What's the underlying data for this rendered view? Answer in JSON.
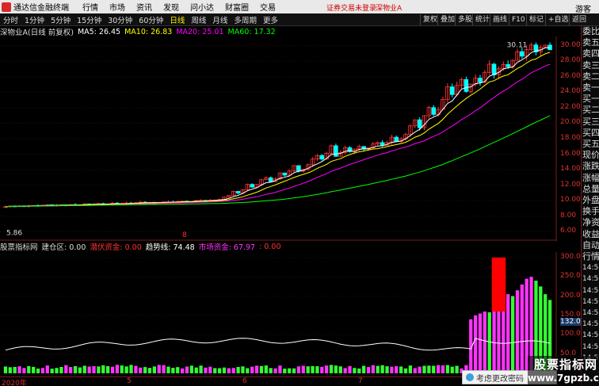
{
  "menubar": {
    "app_name": "通达信金融终端",
    "items": [
      "行情",
      "市场",
      "资讯",
      "发现",
      "问小达",
      "财富圈",
      "交易"
    ],
    "notice": "证券交易未登录",
    "stock_link": "深物业A",
    "guest": "游客"
  },
  "toolbar": {
    "periods": [
      "分时",
      "1分钟",
      "5分钟",
      "15分钟",
      "30分钟",
      "60分钟",
      "日线",
      "周线",
      "月线",
      "多周期",
      "更多"
    ],
    "active_period": "日线",
    "right_buttons": [
      "复权",
      "叠加",
      "多股",
      "统计",
      "画线",
      "F10",
      "标记",
      "+自选",
      "返回"
    ]
  },
  "chart_header": {
    "title": "深物业A(日线 前复权)",
    "ma5_label": "MA5: 26.45",
    "ma10_label": "MA10: 26.83",
    "ma20_label": "MA20: 25.01",
    "ma60_label": "MA60: 17.32"
  },
  "price_axis": [
    "30.00",
    "28.00",
    "26.00",
    "24.00",
    "22.00",
    "20.00",
    "18.00",
    "16.00",
    "14.00",
    "12.00",
    "10.00",
    "8.00",
    "6.00"
  ],
  "annotations": {
    "high_label": "30.11",
    "low_label": "5.86",
    "mark_label": "8"
  },
  "indicator_header": {
    "name": "股票指标网",
    "jcq": "建仓区: 0.00",
    "qiankun": "潜伏资金: 0.00",
    "trend": "趋势线: 74.48",
    "market": "市场资金: 67.97",
    "extra": ": 0.00"
  },
  "indicator_axis": [
    "300.0",
    "250.0",
    "200.0",
    "150.0",
    "100.0",
    "50.0"
  ],
  "indicator_current": "132.05",
  "right_panel": [
    "委比",
    "卖五",
    "卖四",
    "卖三",
    "卖二",
    "卖一",
    "买一",
    "买二",
    "买三",
    "买四",
    "买五",
    "现价",
    "涨跌",
    "涨幅",
    "总量",
    "外盘",
    "换手",
    "净资",
    "收益",
    "自动",
    "行情",
    "14:56",
    "14:56",
    "14:56",
    "14:56",
    "14:56",
    "14:56",
    "14:56",
    "14:56",
    "14:56"
  ],
  "date_axis": [
    "2020年",
    "5",
    "6",
    "7"
  ],
  "overlay": {
    "label": "考虑更改密码"
  },
  "watermark": {
    "line1": "股票指标网",
    "line2": "www.7gpzb.com"
  },
  "colors": {
    "up": "#ff3333",
    "down": "#00ffff",
    "ma5": "#ffffff",
    "ma10": "#ffff00",
    "ma20": "#ff00ff",
    "ma60": "#00ff00",
    "red_bar": "#ff0000",
    "magenta_bar": "#ff33ff",
    "green_bar": "#33ff33"
  },
  "chart_data": {
    "type": "candlestick",
    "ylim": [
      5.0,
      31.0
    ],
    "start": 5.9,
    "returns": [
      0.01,
      -0.004,
      0.006,
      -0.008,
      0.012,
      0.002,
      -0.006,
      0.01,
      0.004,
      -0.01,
      0.006,
      0.002,
      -0.002,
      0.008,
      -0.006,
      0.004,
      0.01,
      -0.004,
      0.002,
      0.006,
      -0.008,
      0.004,
      0.012,
      -0.006,
      0.002,
      0.004,
      -0.002,
      0.006,
      0.008,
      -0.004,
      0.002,
      -0.006,
      0.004,
      0.006,
      0.002,
      -0.002,
      0.008,
      0.004,
      -0.006,
      0.002,
      0.01,
      0.004,
      -0.004,
      0.006,
      0.002,
      0.008,
      0.03,
      0.02,
      0.05,
      -0.02,
      0.04,
      0.06,
      -0.03,
      0.03,
      0.05,
      0.02,
      -0.04,
      0.03,
      0.06,
      -0.02,
      0.04,
      0.05,
      -0.05,
      0.02,
      0.04,
      0.05,
      0.03,
      -0.03,
      0.05,
      0.06,
      -0.08,
      0.03,
      0.04,
      -0.03,
      0.02,
      0.02,
      -0.02,
      0.01,
      0.03,
      0.01,
      -0.02,
      0.02,
      0.04,
      -0.03,
      0.02,
      0.03,
      0.06,
      0.04,
      -0.05,
      0.08,
      0.05,
      -0.04,
      0.03,
      0.06,
      0.07,
      -0.04,
      0.05,
      0.03,
      -0.06,
      0.04,
      0.03,
      -0.02,
      0.05,
      0.04,
      -0.05,
      0.03,
      0.02,
      -0.01,
      0.03,
      0.04,
      -0.02,
      0.03,
      0.02,
      -0.03,
      0.02,
      0.01,
      -0.02
    ],
    "ma60_end": 17.32,
    "indicator": {
      "ylim": [
        0,
        310
      ],
      "red_blocks": [
        [
          105,
          108,
          160,
          300
        ],
        [
          122,
          125,
          150,
          300
        ],
        [
          130,
          133,
          140,
          300
        ],
        [
          165,
          170,
          100,
          300
        ],
        [
          170,
          175,
          100,
          300
        ]
      ],
      "columns_start": 100,
      "columns": [
        140,
        150,
        155,
        160,
        158,
        170,
        175,
        190,
        205,
        200,
        215,
        230,
        245,
        250,
        240,
        225,
        205,
        190,
        175,
        160,
        150,
        140,
        130,
        120,
        110,
        100,
        95,
        90,
        85,
        90,
        95,
        100,
        110,
        120,
        140,
        150,
        170,
        180,
        195,
        210,
        250,
        270,
        290,
        300,
        295,
        290,
        280,
        270,
        260,
        250,
        235,
        215,
        190,
        170,
        150,
        130,
        110,
        100,
        95,
        90,
        85,
        80,
        80,
        90,
        100,
        110,
        130,
        150,
        170,
        190,
        200,
        210,
        205,
        190,
        170,
        150,
        130,
        110,
        95,
        80
      ],
      "line_value": 132.05
    }
  }
}
